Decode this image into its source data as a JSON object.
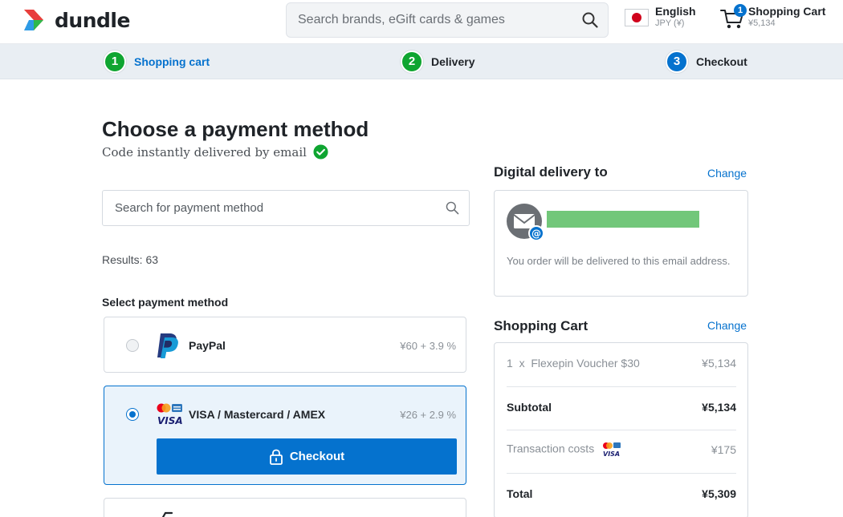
{
  "header": {
    "logo_text": "dundle",
    "search_placeholder": "Search brands, eGift cards & games",
    "language": "English",
    "currency": "JPY (¥)",
    "cart_label": "Shopping Cart",
    "cart_amount": "¥5,134",
    "cart_count": "1"
  },
  "steps": [
    {
      "num": "1",
      "label": "Shopping cart"
    },
    {
      "num": "2",
      "label": "Delivery"
    },
    {
      "num": "3",
      "label": "Checkout"
    }
  ],
  "main": {
    "title": "Choose a payment method",
    "subtitle": "Code instantly delivered by email",
    "search_placeholder": "Search for payment method",
    "results": "Results: 63",
    "select_label": "Select payment method",
    "methods": [
      {
        "name": "PayPal",
        "fee": "¥60 + 3.9 %"
      },
      {
        "name": "VISA / Mastercard / AMEX",
        "fee": "¥26 + 2.9 %"
      }
    ],
    "checkout_label": "Checkout"
  },
  "delivery": {
    "title": "Digital delivery to",
    "change": "Change",
    "note": "You order will be delivered to this email address."
  },
  "cart": {
    "title": "Shopping Cart",
    "change": "Change",
    "item_qty": "1",
    "item_x": "x",
    "item_name": "Flexepin Voucher $30",
    "item_price": "¥5,134",
    "subtotal_label": "Subtotal",
    "subtotal": "¥5,134",
    "transaction_label": "Transaction costs",
    "transaction": "¥175",
    "total_label": "Total",
    "total": "¥5,309"
  },
  "colors": {
    "accent": "#0572ce",
    "step_green": "#0fa531",
    "email_mask": "#72c77a"
  }
}
